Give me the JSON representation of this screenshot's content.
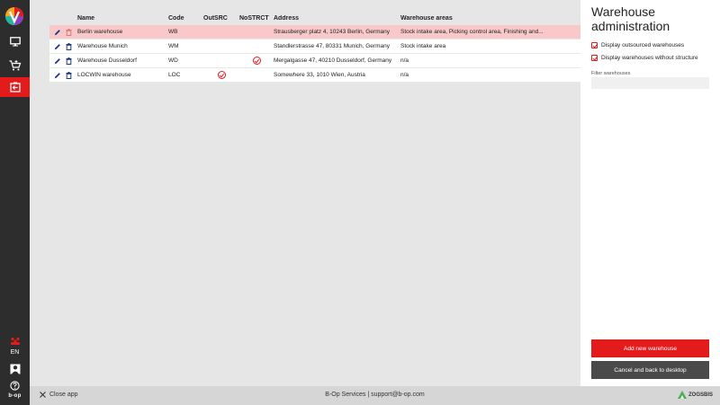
{
  "nav": {
    "lang": "EN",
    "brand": "b-op",
    "colors": {
      "bg": "#2d2d2d",
      "active": "#e41b1b"
    }
  },
  "table": {
    "headers": {
      "name": "Name",
      "code": "Code",
      "outsrc": "OutSRC",
      "nostrct": "NoSTRCT",
      "address": "Address",
      "areas": "Warehouse areas"
    },
    "rows": [
      {
        "name": "Berlin warehouse",
        "code": "WB",
        "outsrc": false,
        "nostrct": false,
        "address": "Strausberger platz 4, 10243 Berlin, Germany",
        "areas": "Stock intake area, Picking control area, Finishing and...",
        "selected": true
      },
      {
        "name": "Warehouse Munich",
        "code": "WM",
        "outsrc": false,
        "nostrct": false,
        "address": "Standlerstrasse 47, 80331 Munich, Germany",
        "areas": "Stock intake area",
        "selected": false
      },
      {
        "name": "Warehouse Dusseldorf",
        "code": "WD",
        "outsrc": false,
        "nostrct": true,
        "address": "Mergalgasse 47, 40210 Dusseldorf, Germany",
        "areas": "n/a",
        "selected": false
      },
      {
        "name": "LOCWIN warehouse",
        "code": "LOC",
        "outsrc": true,
        "nostrct": false,
        "address": "Somewhere 33, 1010 Wien, Austria",
        "areas": "n/a",
        "selected": false
      }
    ]
  },
  "panel": {
    "title": "Warehouse administration",
    "opt_outsourced": "Display outsourced warehouses",
    "opt_nostructure": "Display warehouses without structure",
    "filter_label": "Filter warehouses",
    "filter_value": "",
    "add_button": "Add new warehouse",
    "cancel_button": "Cancel and back to desktop"
  },
  "footer": {
    "close_app": "Close app",
    "center": "B-Op Services | support@b-op.com",
    "logo_text": "ZOGSBIS"
  },
  "colors": {
    "accent": "#e41b1b",
    "selected_row": "#f9c9c9",
    "cancel_btn": "#4a4a4a"
  }
}
